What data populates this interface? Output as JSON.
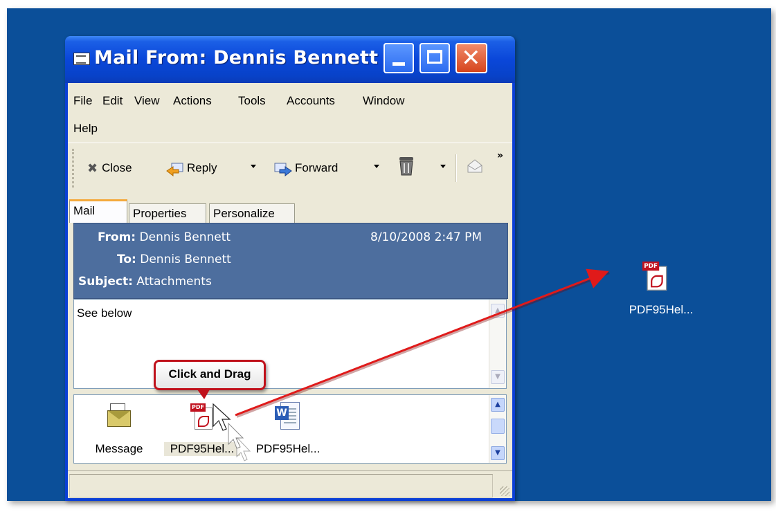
{
  "window": {
    "title": "Mail From: Dennis Bennett",
    "minimize": "_",
    "maximize": "□",
    "close": "✕"
  },
  "menu": [
    "File",
    "Edit",
    "View",
    "Actions",
    "Tools",
    "Accounts",
    "Window",
    "Help"
  ],
  "toolbar": {
    "close_label": "Close",
    "reply_label": "Reply",
    "forward_label": "Forward",
    "more_chevron": "»"
  },
  "tabs": [
    "Mail",
    "Properties",
    "Personalize"
  ],
  "header": {
    "from_label": "From:",
    "from_value": "Dennis Bennett",
    "date": "8/10/2008 2:47 PM",
    "to_label": "To:",
    "to_value": "Dennis Bennett",
    "subject_label": "Subject:",
    "subject_value": "Attachments"
  },
  "body": {
    "text": "See below"
  },
  "attachments": [
    {
      "label": "Message",
      "icon": "message-icon"
    },
    {
      "label": "PDF95Hel...",
      "icon": "pdf-icon"
    },
    {
      "label": "PDF95Hel...",
      "icon": "word-doc-icon"
    }
  ],
  "callout": {
    "text": "Click and Drag"
  },
  "desktop_icon": {
    "label": "PDF95Hel...",
    "icon": "pdf-icon"
  },
  "colors": {
    "desktop": "#0b4f99",
    "header_panel": "#4d6e9e",
    "annotation_red": "#e01a1a"
  }
}
